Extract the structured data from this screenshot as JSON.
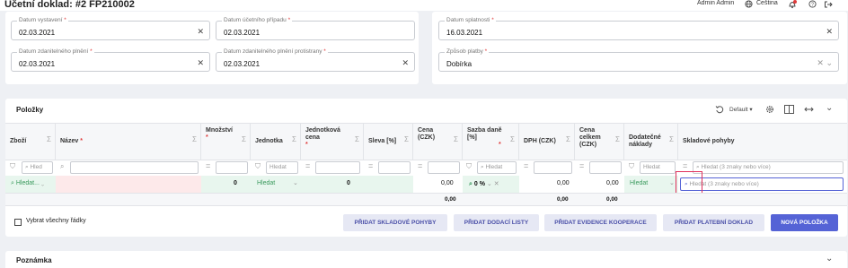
{
  "page_title": "Účetní doklad: #2 FP210002",
  "topbar": {
    "user": "Admin Admin",
    "language": "Čeština",
    "notif_count": ""
  },
  "fields": {
    "datum_vystaveni": {
      "label": "Datum vystavení",
      "value": "02.03.2021"
    },
    "datum_ucetniho_pripadu": {
      "label": "Datum účetního případu",
      "value": "02.03.2021"
    },
    "datum_splatnosti": {
      "label": "Datum splatnosti",
      "value": "16.03.2021"
    },
    "datum_zdanitelneho_plneni": {
      "label": "Datum zdanitelného plnění",
      "value": "02.03.2021"
    },
    "datum_zdanitelneho_plneni_protistrany": {
      "label": "Datum zdanitelného plnění protistrany",
      "value": "02.03.2021"
    },
    "zpusob_platby": {
      "label": "Způsob platby",
      "value": "Dobírka"
    }
  },
  "polozky": {
    "title": "Položky",
    "view_select": "Default",
    "columns": {
      "zbozi": "Zboží",
      "nazev": "Název",
      "mnozstvi": "Množství",
      "jednotka": "Jednotka",
      "jednotkova_cena": "Jednotková cena",
      "sleva": "Sleva [%]",
      "cena": "Cena (CZK)",
      "sazba_dane": "Sazba daně [%]",
      "dph": "DPH (CZK)",
      "cena_celkem": "Cena celkem (CZK)",
      "dodatecne_naklady": "Dodatečné náklady",
      "skladove_pohyby": "Skladové pohyby"
    },
    "filters": {
      "zbozi": "Hled",
      "jednotka": "Hledat",
      "sazba": "Hledat",
      "dodatecne": "Hledat",
      "skladove": "Hledat (3 znaky nebo více)"
    },
    "row": {
      "zbozi": "Hledat...",
      "mnozstvi": "0",
      "jednotka": "Hledat",
      "jednotkova_cena": "0",
      "cena": "0,00",
      "sazba": "0 %",
      "dph": "0,00",
      "cena_celkem": "0,00",
      "dodatecne": "Hledat",
      "skladove": "Hledat (3 znaky nebo více)"
    },
    "totals": {
      "cena": "0,00",
      "dph": "0,00",
      "cena_celkem": "0,00"
    },
    "select_all": "Vybrat všechny řádky",
    "buttons": {
      "skladove": "PŘIDAT SKLADOVÉ POHYBY",
      "dodaci": "PŘIDAT DODACÍ LISTY",
      "kooperace": "PŘIDAT EVIDENCE KOOPERACE",
      "platebni": "PŘIDAT PLATEBNÍ DOKLAD",
      "nova": "NOVÁ POLOŽKA"
    }
  },
  "poznamka": {
    "title": "Poznámka"
  },
  "colors": {
    "accent": "#5563d6",
    "highlight": "#e0315c",
    "row_green": "#e8f6ee",
    "row_red": "#fde9ea"
  }
}
